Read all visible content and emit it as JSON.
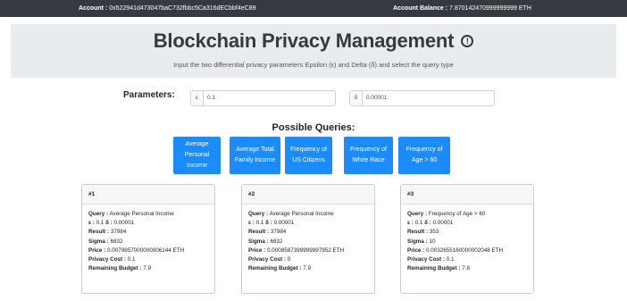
{
  "topbar": {
    "account_label": "Account :",
    "account_value": "0x522941d473047baC732fbbc5Ca316dECbbf4eC89",
    "balance_label": "Account Balance :",
    "balance_value": "7.870142470999999999 ETH"
  },
  "hero": {
    "title": "Blockchain Privacy Management",
    "info_glyph": "!",
    "subtitle": "Input the two differential privacy parameters Epsilon (ε) and Delta (δ) and select the query type"
  },
  "params": {
    "label": "Parameters:",
    "epsilon_prefix": "ε",
    "epsilon_value": "0.1",
    "delta_prefix": "δ",
    "delta_value": "0.00001"
  },
  "queries": {
    "title": "Possible Queries:",
    "buttons": [
      "Average Personal Income",
      "Average Total Family Income",
      "Frequency of US Citizens",
      "Frequency of White Race",
      "Frequency of Age > 60"
    ]
  },
  "labels": {
    "query": "Query :",
    "eps": "ε :",
    "delta": "δ :",
    "result": "Result :",
    "sigma": "Sigma :",
    "price": "Price :",
    "privacy_cost": "Privacy Cost :",
    "remaining_budget": "Remaining Budget :"
  },
  "cards": [
    {
      "id": "#1",
      "query": "Average Personal Income",
      "eps": "0.1",
      "delta": "0.00001",
      "result": "37984",
      "sigma": "6832",
      "price": "0.0079857000000006144 ETH",
      "privacy_cost": "0.1",
      "remaining_budget": "7.9"
    },
    {
      "id": "#2",
      "query": "Average Personal Income",
      "eps": "0.1",
      "delta": "0.00001",
      "result": "37984",
      "sigma": "6832",
      "price": "0.0008587399999997952 ETH",
      "privacy_cost": "0",
      "remaining_budget": "7.9"
    },
    {
      "id": "#3",
      "query": "Frequency of Age > 60",
      "eps": "0.1",
      "delta": "0.00001",
      "result": "353",
      "sigma": "10",
      "price": "0.0032655160000002048 ETH",
      "privacy_cost": "0.1",
      "remaining_budget": "7.8"
    }
  ]
}
